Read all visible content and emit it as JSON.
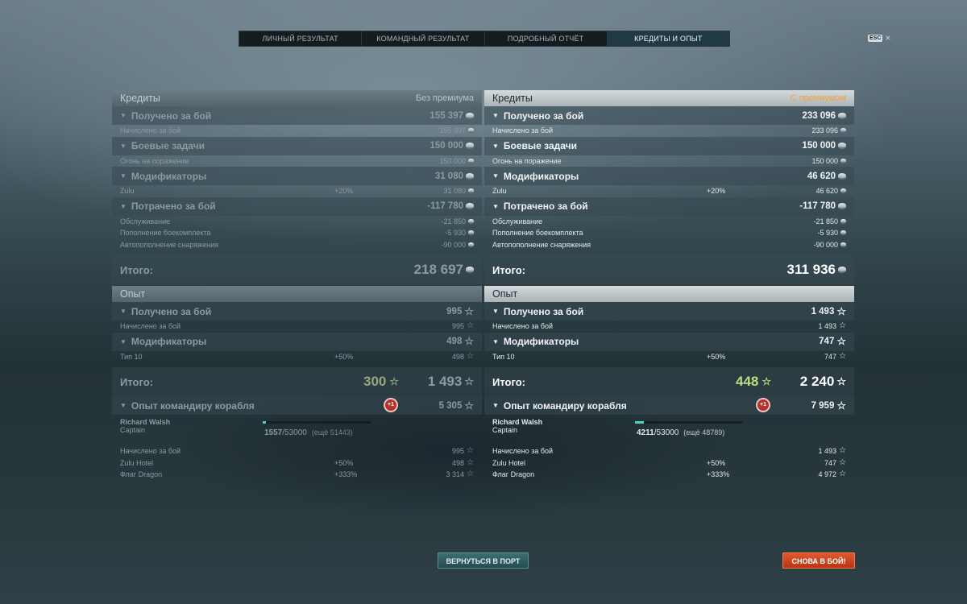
{
  "tabs": [
    "ЛИЧНЫЙ РЕЗУЛЬТАТ",
    "КОМАНДНЫЙ РЕЗУЛЬТАТ",
    "ПОДРОБНЫЙ ОТЧЁТ",
    "КРЕДИТЫ И ОПЫТ"
  ],
  "active_tab": "КРЕДИТЫ И ОПЫТ",
  "esc": {
    "badge": "ESC",
    "close": "×"
  },
  "left": {
    "credits_title": "Кредиты",
    "mode": "Без премиума",
    "earned": {
      "label": "Получено за бой",
      "value": "155 397",
      "items": [
        {
          "label": "Начислено за бой",
          "pct": "",
          "value": "155 397"
        }
      ]
    },
    "tasks": {
      "label": "Боевые задачи",
      "value": "150 000",
      "items": [
        {
          "label": "Огонь на поражение",
          "pct": "",
          "value": "150 000"
        }
      ]
    },
    "mods": {
      "label": "Модификаторы",
      "value": "31 080",
      "items": [
        {
          "label": "Zulu",
          "pct": "+20%",
          "value": "31 080"
        }
      ]
    },
    "spent": {
      "label": "Потрачено за бой",
      "value": "-117 780",
      "items": [
        {
          "label": "Обслуживание",
          "pct": "",
          "value": "-21 850"
        },
        {
          "label": "Пополнение боекомплекта",
          "pct": "",
          "value": "-5 930"
        },
        {
          "label": "Автопополнение снаряжения",
          "pct": "",
          "value": "-90 000"
        }
      ]
    },
    "credits_total": {
      "label": "Итого:",
      "value": "218 697"
    },
    "xp_title": "Опыт",
    "xp_earned": {
      "label": "Получено за бой",
      "value": "995",
      "items": [
        {
          "label": "Начислено за бой",
          "pct": "",
          "value": "995"
        }
      ]
    },
    "xp_mods": {
      "label": "Модификаторы",
      "value": "498",
      "items": [
        {
          "label": "Тип 10",
          "pct": "+50%",
          "value": "498"
        }
      ]
    },
    "xp_total": {
      "label": "Итого:",
      "free": "300",
      "value": "1 493"
    },
    "cmdr": {
      "label": "Опыт командиру корабля",
      "bonus": "+1",
      "value": "5 305",
      "name": "Richard Walsh",
      "rank": "Captain",
      "xp_current": "1557",
      "xp_max": "/53000",
      "remaining": "(ещё 51443)",
      "progress": 0.029,
      "items": [
        {
          "label": "Начислено за бой",
          "pct": "",
          "value": "995"
        },
        {
          "label": "Zulu Hotel",
          "pct": "+50%",
          "value": "498"
        },
        {
          "label": "Флаг Dragon",
          "pct": "+333%",
          "value": "3 314"
        }
      ]
    }
  },
  "right": {
    "credits_title": "Кредиты",
    "mode": "С премиумом",
    "earned": {
      "label": "Получено за бой",
      "value": "233 096",
      "items": [
        {
          "label": "Начислено за бой",
          "pct": "",
          "value": "233 096"
        }
      ]
    },
    "tasks": {
      "label": "Боевые задачи",
      "value": "150 000",
      "items": [
        {
          "label": "Огонь на поражение",
          "pct": "",
          "value": "150 000"
        }
      ]
    },
    "mods": {
      "label": "Модификаторы",
      "value": "46 620",
      "items": [
        {
          "label": "Zulu",
          "pct": "+20%",
          "value": "46 620"
        }
      ]
    },
    "spent": {
      "label": "Потрачено за бой",
      "value": "-117 780",
      "items": [
        {
          "label": "Обслуживание",
          "pct": "",
          "value": "-21 850"
        },
        {
          "label": "Пополнение боекомплекта",
          "pct": "",
          "value": "-5 930"
        },
        {
          "label": "Автопополнение снаряжения",
          "pct": "",
          "value": "-90 000"
        }
      ]
    },
    "credits_total": {
      "label": "Итого:",
      "value": "311 936"
    },
    "xp_title": "Опыт",
    "xp_earned": {
      "label": "Получено за бой",
      "value": "1 493",
      "items": [
        {
          "label": "Начислено за бой",
          "pct": "",
          "value": "1 493"
        }
      ]
    },
    "xp_mods": {
      "label": "Модификаторы",
      "value": "747",
      "items": [
        {
          "label": "Тип 10",
          "pct": "+50%",
          "value": "747"
        }
      ]
    },
    "xp_total": {
      "label": "Итого:",
      "free": "448",
      "value": "2 240"
    },
    "cmdr": {
      "label": "Опыт командиру корабля",
      "bonus": "+1",
      "value": "7 959",
      "name": "Richard Walsh",
      "rank": "Captain",
      "xp_current": "4211",
      "xp_max": "/53000",
      "remaining": "(ещё 48789)",
      "progress": 0.079,
      "items": [
        {
          "label": "Начислено за бой",
          "pct": "",
          "value": "1 493"
        },
        {
          "label": "Zulu Hotel",
          "pct": "+50%",
          "value": "747"
        },
        {
          "label": "Флаг Dragon",
          "pct": "+333%",
          "value": "4 972"
        }
      ]
    }
  },
  "buttons": {
    "back": "ВЕРНУТЬСЯ В ПОРТ",
    "fight": "СНОВА В БОЙ!"
  },
  "colors": {
    "premium_label": "#f1a437",
    "free_xp_premium": "#b9e07e",
    "fight_button": "#c94420",
    "back_button": "#2f5c60"
  }
}
